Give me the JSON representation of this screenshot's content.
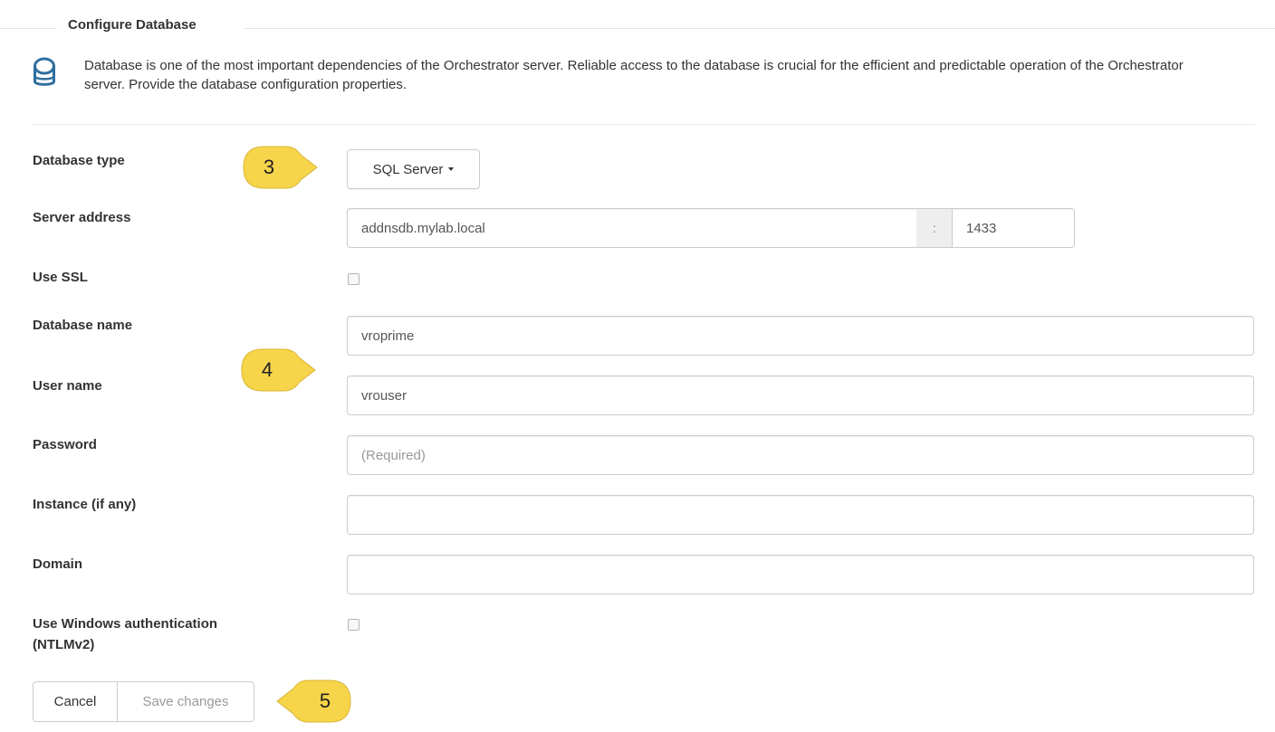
{
  "section": {
    "title": "Configure Database",
    "description": "Database is one of the most important dependencies of the Orchestrator server. Reliable access to the database is crucial for the efficient and predictable operation of the Orchestrator server. Provide the database configuration properties."
  },
  "form": {
    "database_type": {
      "label": "Database type",
      "value": "SQL Server"
    },
    "server_address": {
      "label": "Server address",
      "host": "addnsdb.mylab.local",
      "separator": ":",
      "port": "1433"
    },
    "use_ssl": {
      "label": "Use SSL",
      "checked": false
    },
    "database_name": {
      "label": "Database name",
      "value": "vroprime"
    },
    "user_name": {
      "label": "User name",
      "value": "vrouser"
    },
    "password": {
      "label": "Password",
      "value": "",
      "placeholder": "(Required)"
    },
    "instance": {
      "label": "Instance (if any)",
      "value": ""
    },
    "domain": {
      "label": "Domain",
      "value": ""
    },
    "windows_auth": {
      "label_line1": "Use Windows authentication",
      "label_line2": "(NTLMv2)",
      "checked": false
    }
  },
  "buttons": {
    "cancel": "Cancel",
    "save": "Save changes"
  },
  "callouts": [
    "3",
    "4",
    "5"
  ],
  "colors": {
    "callout_fill": "#f7d54a",
    "icon_blue": "#2f6f9f"
  }
}
